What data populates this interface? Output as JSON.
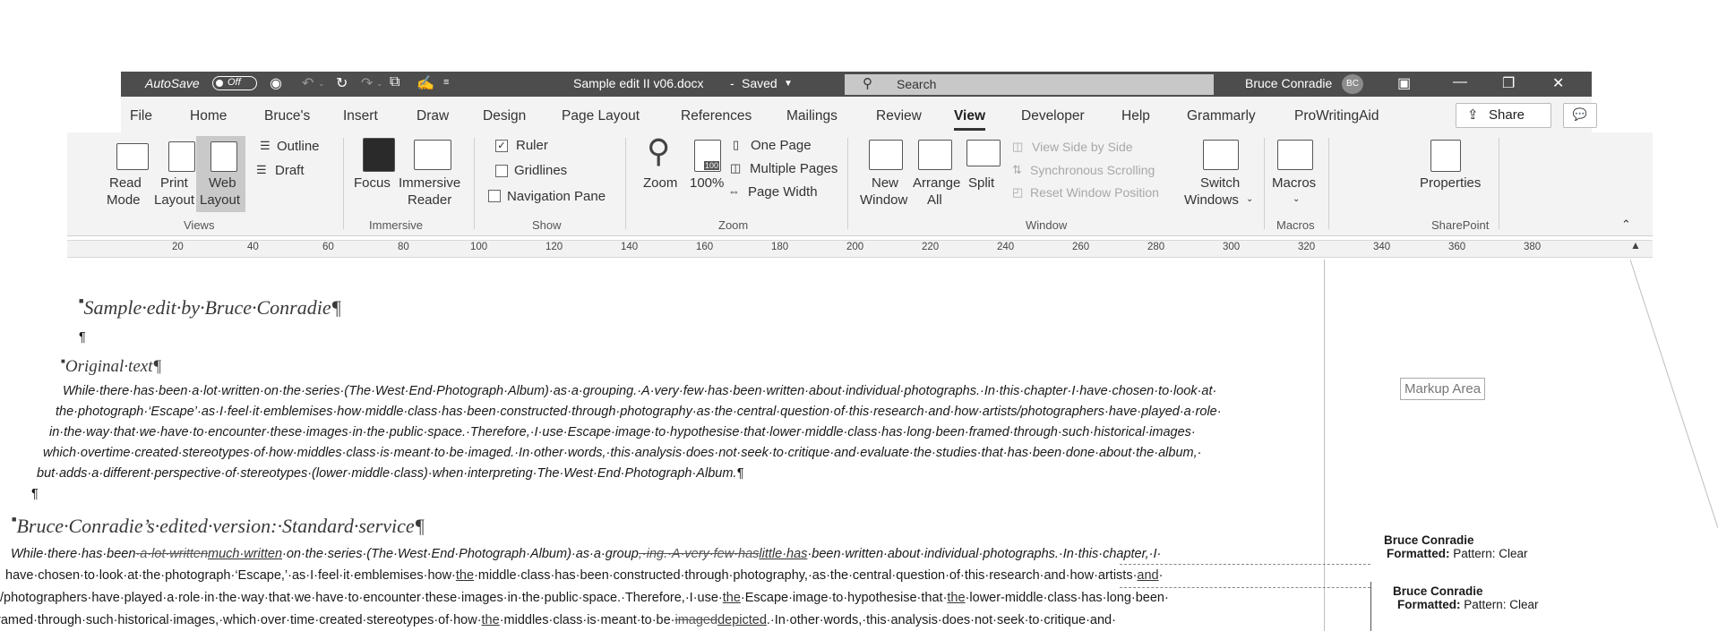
{
  "titlebar": {
    "autosave_label": "AutoSave",
    "autosave_state": "Off",
    "filename": "Sample edit II v06.docx",
    "separator": "-",
    "saved_status": "Saved",
    "search_placeholder": "Search",
    "user_name": "Bruce Conradie",
    "user_initials": "BC"
  },
  "tabs": [
    "File",
    "Home",
    "Bruce's",
    "Insert",
    "Draw",
    "Design",
    "Page Layout",
    "References",
    "Mailings",
    "Review",
    "View",
    "Developer",
    "Help",
    "Grammarly",
    "ProWritingAid"
  ],
  "active_tab": "View",
  "share_label": "Share",
  "ribbon": {
    "views": {
      "read_mode_1": "Read",
      "read_mode_2": "Mode",
      "print_layout_1": "Print",
      "print_layout_2": "Layout",
      "web_layout_1": "Web",
      "web_layout_2": "Layout",
      "outline": "Outline",
      "draft": "Draft",
      "group": "Views"
    },
    "immersive": {
      "focus": "Focus",
      "immersive_reader_1": "Immersive",
      "immersive_reader_2": "Reader",
      "group": "Immersive"
    },
    "show": {
      "ruler": "Ruler",
      "gridlines": "Gridlines",
      "navigation_pane": "Navigation Pane",
      "group": "Show"
    },
    "zoom": {
      "zoom": "Zoom",
      "percent": "100%",
      "icon_label": "100",
      "one_page": "One Page",
      "multiple_pages": "Multiple Pages",
      "page_width": "Page Width",
      "group": "Zoom"
    },
    "window": {
      "new_window_1": "New",
      "new_window_2": "Window",
      "arrange_all_1": "Arrange",
      "arrange_all_2": "All",
      "split": "Split",
      "view_side_by_side": "View Side by Side",
      "synchronous_scrolling": "Synchronous Scrolling",
      "reset_window_position": "Reset Window Position",
      "switch_windows_1": "Switch",
      "switch_windows_2": "Windows",
      "group": "Window"
    },
    "macros": {
      "macros": "Macros",
      "group": "Macros"
    },
    "sharepoint": {
      "properties": "Properties",
      "group": "SharePoint"
    }
  },
  "ruler_ticks": [
    "20",
    "40",
    "60",
    "80",
    "100",
    "120",
    "140",
    "160",
    "180",
    "200",
    "220",
    "240",
    "260",
    "280",
    "300",
    "320",
    "340",
    "360",
    "380"
  ],
  "document": {
    "heading1": "Sample·edit·by·Bruce·Conradie¶",
    "empty_para": "¶",
    "heading2": "Original·text¶",
    "original_lines": [
      "While·there·has·been·a·lot·written·on·the·series·(The·West·End·Photograph·Album)·as·a·grouping.·A·very·few·has·been·written·about·individual·photographs.·In·this·chapter·I·have·chosen·to·look·at·",
      "the·photograph·‘Escape’·as·I·feel·it·emblemises·how·middle·class·has·been·constructed·through·photography·as·the·central·question·of·this·research·and·how·artists/photographers·have·played·a·role·",
      "in·the·way·that·we·have·to·encounter·these·images·in·the·public·space.·Therefore,·I·use·Escape·image·to·hypothesise·that·lower·middle·class·has·long·been·framed·through·such·historical·images·",
      "which·overtime·created·stereotypes·of·how·middles·class·is·meant·to·be·imaged.·In·other·words,·this·analysis·does·not·seek·to·critique·and·evaluate·the·studies·that·has·been·done·about·the·album,·",
      "but·adds·a·different·perspective·of·stereotypes·(lower·middle·class)·when·interpreting·The·West·End·Photograph·Album.¶"
    ],
    "empty_para2": "¶",
    "heading3": "Bruce·Conradie’s·edited·version:·Standard·service¶",
    "edited_line1": [
      {
        "t": "While·there·has·been",
        "k": "n"
      },
      {
        "t": "·a·lot·written",
        "k": "d"
      },
      {
        "t": "much·written",
        "k": "i"
      },
      {
        "t": "·on·the·series·(The·West·End·Photograph·Album)·as·a·group",
        "k": "n"
      },
      {
        "t": ",·ing.·A·very·few·has",
        "k": "d"
      },
      {
        "t": "little·has",
        "k": "i"
      },
      {
        "t": "·been·written·about·individual·photographs.·In·this·chapter,·I·",
        "k": "n"
      }
    ],
    "edited_line2": [
      {
        "t": "have·chosen·to·look·at·the·photograph·‘Escape,’·as·I·feel·it·emblemises·how·",
        "k": "n"
      },
      {
        "t": "the",
        "k": "i"
      },
      {
        "t": "·middle·class·has·been·constructed·through·photography,·as·the·central·question·of·this·research·and·how·artists·",
        "k": "n"
      },
      {
        "t": "and",
        "k": "i"
      },
      {
        "t": "·",
        "k": "n"
      }
    ],
    "edited_line3": [
      {
        "t": "/photographers·have·played·a·role·in·the·way·that·we·have·to·encounter·these·images·in·the·public·space.·Therefore,·I·use·",
        "k": "n"
      },
      {
        "t": "the",
        "k": "i"
      },
      {
        "t": "·Escape·image·to·hypothesise·that·",
        "k": "n"
      },
      {
        "t": "the",
        "k": "i"
      },
      {
        "t": "·lower-middle·class·has·long·been·",
        "k": "n"
      }
    ],
    "edited_line4": [
      {
        "t": "ramed·through·such·historical·images,·which·over·time·created·stereotypes·of·how·",
        "k": "n"
      },
      {
        "t": "the",
        "k": "i"
      },
      {
        "t": "·middles·class·is·meant·to·be·",
        "k": "n"
      },
      {
        "t": "imaged",
        "k": "d"
      },
      {
        "t": "depicted",
        "k": "i"
      },
      {
        "t": ".·In·other·words,·this·analysis·does·not·seek·to·critique·and·",
        "k": "n"
      }
    ]
  },
  "markup_area_label": "Markup Area",
  "comments": [
    {
      "author": "Bruce Conradie",
      "label": "Formatted:",
      "text": "Pattern: Clear"
    },
    {
      "author": "Bruce Conradie",
      "label": "Formatted:",
      "text": "Pattern: Clear"
    }
  ]
}
